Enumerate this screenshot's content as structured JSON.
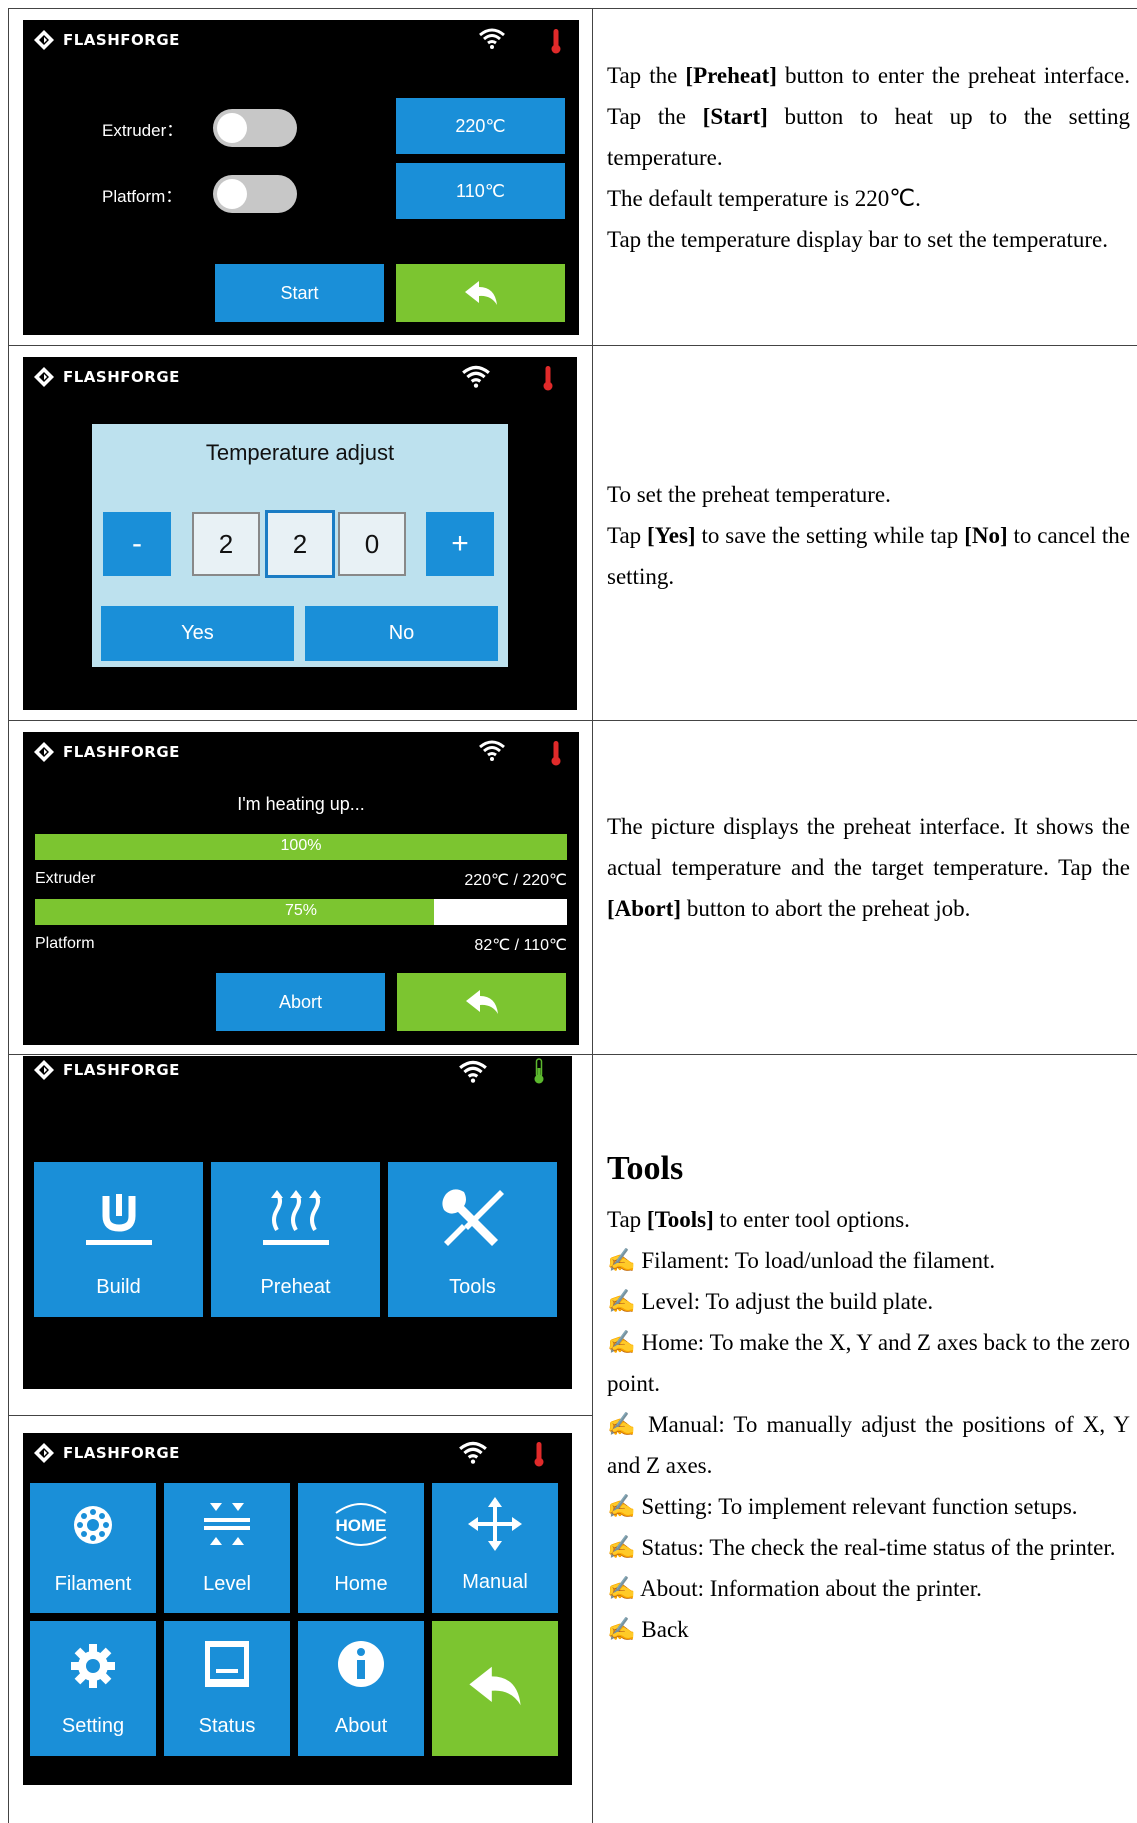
{
  "brand": "FLASHFORGE",
  "colors": {
    "accent": "#1a8fd8",
    "green": "#7cc530",
    "dialog_bg": "#bde1ee",
    "thermo_red": "#e02a2a",
    "thermo_green": "#5cb82e"
  },
  "screens": {
    "preheat": {
      "extruder_label": "Extruder：",
      "platform_label": "Platform：",
      "extruder_temp": "220℃",
      "platform_temp": "110℃",
      "start_label": "Start",
      "back_icon": "back-arrow-icon"
    },
    "temp_adjust": {
      "title": "Temperature adjust",
      "minus": "-",
      "plus": "+",
      "digits": [
        "2",
        "2",
        "0"
      ],
      "yes_label": "Yes",
      "no_label": "No"
    },
    "heating": {
      "title": "I'm heating up...",
      "extruder_progress": 1.0,
      "extruder_pct": "100%",
      "extruder_label": "Extruder",
      "extruder_temp": "220℃ / 220℃",
      "platform_progress": 0.75,
      "platform_pct": "75%",
      "platform_label": "Platform",
      "platform_temp": "82℃ / 110℃",
      "abort_label": "Abort"
    },
    "main_menu": {
      "build_label": "Build",
      "preheat_label": "Preheat",
      "tools_label": "Tools"
    },
    "tools_menu": {
      "filament_label": "Filament",
      "level_label": "Level",
      "home_label": "Home",
      "home_icon_text": "HOME",
      "manual_label": "Manual",
      "setting_label": "Setting",
      "status_label": "Status",
      "about_label": "About"
    }
  },
  "text": {
    "row1": {
      "p1a": "Tap the ",
      "p1b": "[Preheat]",
      "p1c": " button to enter the preheat interface. Tap the ",
      "p1d": "[Start]",
      "p1e": " button to heat up to the setting temperature.",
      "p2": "The default temperature is 220℃.",
      "p3": "Tap the temperature display bar to set the temperature."
    },
    "row2": {
      "p1": "To set the preheat temperature.",
      "p2a": "Tap ",
      "p2b": "[Yes]",
      "p2c": " to save the setting while tap ",
      "p2d": "[No]",
      "p2e": " to cancel the setting."
    },
    "row3": {
      "p1a": "The picture displays the preheat interface. It shows the actual temperature and the target temperature. Tap the ",
      "p1b": "[Abort]",
      "p1c": " button to abort the preheat job."
    },
    "row4": {
      "heading": "Tools",
      "intro_a": "Tap ",
      "intro_b": "[Tools]",
      "intro_c": " to enter tool options.",
      "bullet": "✍",
      "items": [
        "Filament: To load/unload the filament.",
        "Level: To adjust the build plate.",
        "Home: To make the X, Y and Z axes back to the zero point.",
        "Manual: To manually adjust the positions of X, Y and Z axes.",
        "Setting: To implement relevant function setups.",
        "Status: The check the real-time status of the printer.",
        "About: Information about the printer.",
        "Back"
      ]
    }
  }
}
